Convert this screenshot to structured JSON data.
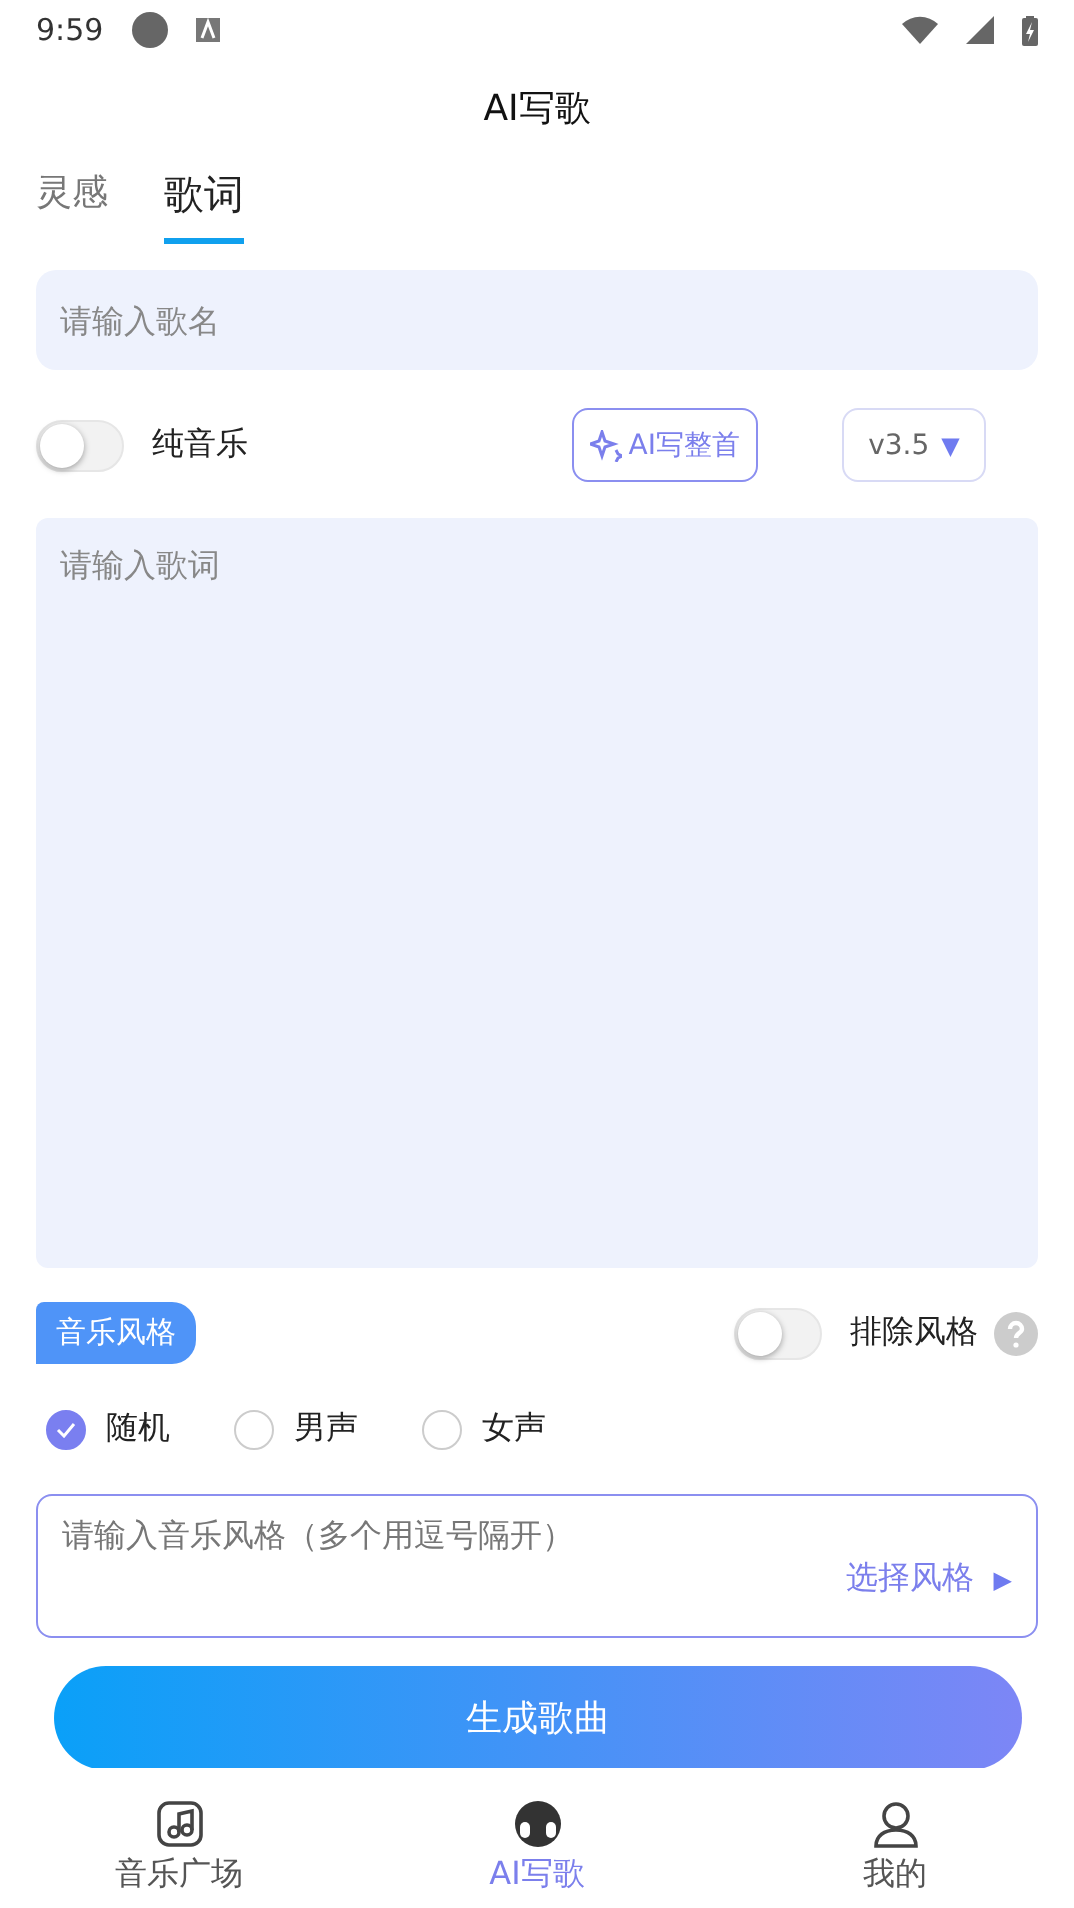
{
  "status_bar": {
    "time": "9:59"
  },
  "header": {
    "title": "AI写歌"
  },
  "tabs": [
    {
      "label": "灵感",
      "selected": false
    },
    {
      "label": "歌词",
      "selected": true
    }
  ],
  "song_name": {
    "placeholder": "请输入歌名"
  },
  "pure_music": {
    "label": "纯音乐",
    "on": false
  },
  "ai_button": {
    "label": "AI写整首"
  },
  "version": {
    "value": "v3.5",
    "caret": "▼"
  },
  "lyrics": {
    "placeholder": "请输入歌词"
  },
  "style_section": {
    "tag": "音乐风格",
    "exclude_label": "排除风格",
    "exclude_on": false
  },
  "voices": [
    {
      "label": "随机",
      "selected": true
    },
    {
      "label": "男声",
      "selected": false
    },
    {
      "label": "女声",
      "selected": false
    }
  ],
  "style_field": {
    "placeholder": "请输入音乐风格（多个用逗号隔开）",
    "pick_label": "选择风格",
    "pick_caret": "▶"
  },
  "generate_button": {
    "label": "生成歌曲"
  },
  "nav": [
    {
      "label": "音乐广场",
      "selected": false
    },
    {
      "label": "AI写歌",
      "selected": true
    },
    {
      "label": "我的",
      "selected": false
    }
  ]
}
